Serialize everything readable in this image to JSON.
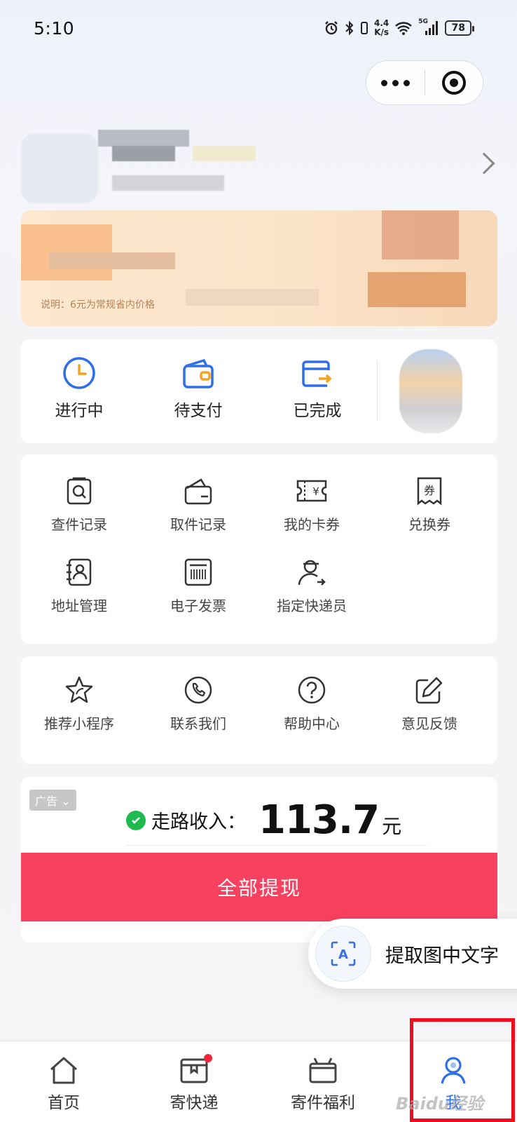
{
  "status_bar": {
    "time": "5:10",
    "net_speed_value": "4.4",
    "net_speed_unit": "K/s",
    "signal_label": "5G",
    "battery": "78"
  },
  "capsule": {
    "more_icon": "more-dots-icon",
    "close_icon": "target-icon"
  },
  "promo": {
    "note": "说明：6元为常规省内价格"
  },
  "orders": {
    "items": [
      {
        "label": "进行中",
        "icon": "clock-icon"
      },
      {
        "label": "待支付",
        "icon": "wallet-icon"
      },
      {
        "label": "已完成",
        "icon": "box-arrow-icon"
      }
    ]
  },
  "services": {
    "items": [
      {
        "label": "查件记录",
        "icon": "search-doc-icon"
      },
      {
        "label": "取件记录",
        "icon": "mailbox-icon"
      },
      {
        "label": "我的卡券",
        "icon": "ticket-icon"
      },
      {
        "label": "兑换券",
        "icon": "coupon-icon"
      },
      {
        "label": "地址管理",
        "icon": "address-book-icon"
      },
      {
        "label": "电子发票",
        "icon": "invoice-icon"
      },
      {
        "label": "指定快递员",
        "icon": "courier-icon"
      }
    ]
  },
  "support": {
    "items": [
      {
        "label": "推荐小程序",
        "icon": "star-icon"
      },
      {
        "label": "联系我们",
        "icon": "phone-icon"
      },
      {
        "label": "帮助中心",
        "icon": "help-icon"
      },
      {
        "label": "意见反馈",
        "icon": "edit-icon"
      }
    ]
  },
  "ad": {
    "tag": "广告",
    "walk_label": "走路收入：",
    "amount": "113.7",
    "unit": "元",
    "withdraw_button": "全部提现"
  },
  "float": {
    "label": "提取图中文字"
  },
  "tabbar": {
    "items": [
      {
        "label": "首页",
        "icon": "home-icon"
      },
      {
        "label": "寄快递",
        "icon": "parcel-icon"
      },
      {
        "label": "寄件福利",
        "icon": "gift-icon"
      },
      {
        "label": "我",
        "icon": "user-icon"
      }
    ]
  },
  "watermark": "Baidu经验",
  "colors": {
    "accent_red": "#f8405f",
    "success_green": "#1fba4f",
    "icon_blue": "#2f6fe8",
    "icon_orange": "#f4a21f",
    "highlight_red": "#f00c1f"
  }
}
